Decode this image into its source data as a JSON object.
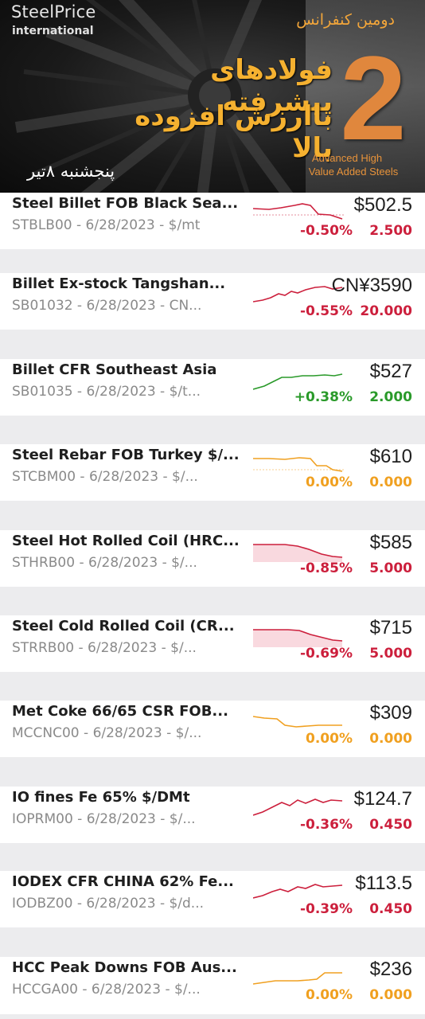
{
  "banner": {
    "brand_name": "SteelPrice",
    "brand_sub": "international",
    "conference_label": "دومین کنفرانس",
    "title_line1": "فولادهای پیشرفته",
    "title_line2": "باارزش افزوده بالا",
    "number": "2",
    "english_line1": "Advanced High",
    "english_line2": "Value Added Steels",
    "date": "پنجشنبه ۸تیر"
  },
  "colors": {
    "negative": "#cc1f3c",
    "positive": "#2a9a2a",
    "neutral": "#f0a020"
  },
  "rows": [
    {
      "name": "Steel Billet FOB Black Sea...",
      "sub": "STBLB00 - 6/28/2023 - $/mt",
      "price": "$502.5",
      "pct": "-0.50%",
      "change": "2.500",
      "trend": "neg"
    },
    {
      "name": "Billet Ex-stock Tangshan...",
      "sub": "SB01032 - 6/28/2023 - CN...",
      "price": "CN¥3590",
      "pct": "-0.55%",
      "change": "20.000",
      "trend": "neg"
    },
    {
      "name": "Billet CFR Southeast Asia",
      "sub": "SB01035 - 6/28/2023 - $/t...",
      "price": "$527",
      "pct": "+0.38%",
      "change": "2.000",
      "trend": "pos"
    },
    {
      "name": "Steel Rebar FOB Turkey $/...",
      "sub": "STCBM00 - 6/28/2023 - $/...",
      "price": "$610",
      "pct": "0.00%",
      "change": "0.000",
      "trend": "flat"
    },
    {
      "name": "Steel Hot Rolled Coil (HRC...",
      "sub": "STHRB00 - 6/28/2023 - $/...",
      "price": "$585",
      "pct": "-0.85%",
      "change": "5.000",
      "trend": "neg"
    },
    {
      "name": "Steel Cold Rolled Coil (CR...",
      "sub": "STRRB00 - 6/28/2023 - $/...",
      "price": "$715",
      "pct": "-0.69%",
      "change": "5.000",
      "trend": "neg"
    },
    {
      "name": "Met Coke 66/65 CSR FOB...",
      "sub": "MCCNC00 - 6/28/2023 - $/...",
      "price": "$309",
      "pct": "0.00%",
      "change": "0.000",
      "trend": "flat"
    },
    {
      "name": "IO fines Fe 65% $/DMt",
      "sub": "IOPRM00 - 6/28/2023 - $/...",
      "price": "$124.7",
      "pct": "-0.36%",
      "change": "0.450",
      "trend": "neg"
    },
    {
      "name": "IODEX CFR CHINA 62% Fe...",
      "sub": "IODBZ00 - 6/28/2023 - $/d...",
      "price": "$113.5",
      "pct": "-0.39%",
      "change": "0.450",
      "trend": "neg"
    },
    {
      "name": "HCC Peak Downs FOB Aus...",
      "sub": "HCCGA00 - 6/28/2023 - $/...",
      "price": "$236",
      "pct": "0.00%",
      "change": "0.000",
      "trend": "flat"
    }
  ]
}
